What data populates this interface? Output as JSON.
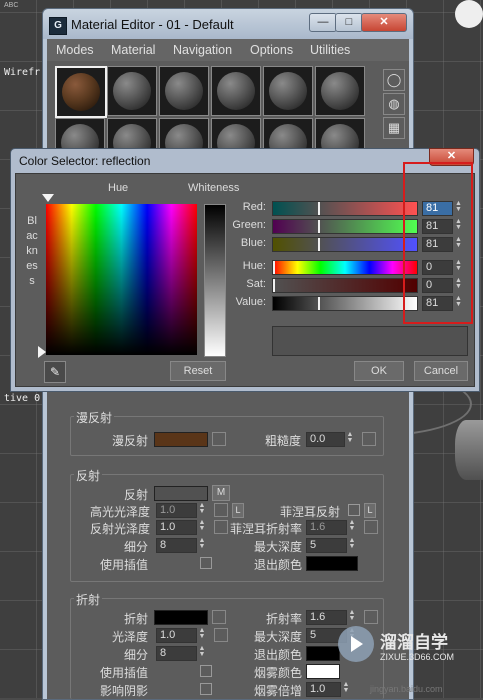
{
  "viewport": {
    "abc_label": "ABC",
    "wireframe_label": "Wirefr",
    "active_label": "tive 0"
  },
  "material_editor": {
    "title": "Material Editor - 01 - Default",
    "app_icon": "G",
    "window_buttons": {
      "minimize": "—",
      "maximize": "□",
      "close": "✕"
    },
    "menus": [
      "Modes",
      "Material",
      "Navigation",
      "Options",
      "Utilities"
    ],
    "side_tools": [
      {
        "name": "sample-type-icon",
        "glyph": "◯"
      },
      {
        "name": "backlight-icon",
        "glyph": "◍"
      },
      {
        "name": "background-checker-icon",
        "glyph": "▦"
      }
    ]
  },
  "color_selector": {
    "title": "Color Selector: reflection",
    "close": "✕",
    "hue_label": "Hue",
    "whiteness_label": "Whiteness",
    "blackness_label": "Blackness",
    "channels": [
      {
        "label": "Red:",
        "value": "81",
        "fraction": 0.318
      },
      {
        "label": "Green:",
        "value": "81",
        "fraction": 0.318
      },
      {
        "label": "Blue:",
        "value": "81",
        "fraction": 0.318
      },
      {
        "label": "Hue:",
        "value": "0",
        "fraction": 0.0
      },
      {
        "label": "Sat:",
        "value": "0",
        "fraction": 0.0
      },
      {
        "label": "Value:",
        "value": "81",
        "fraction": 0.318
      }
    ],
    "eyedropper_icon": "eyedropper-icon",
    "buttons": {
      "reset": "Reset",
      "ok": "OK",
      "cancel": "Cancel"
    },
    "preview_color": "#515151",
    "annotation_color": "#d61c1c"
  },
  "rollout": {
    "diffuse_group": {
      "title": "漫反射",
      "diffuse_label": "漫反射",
      "diffuse_color": "#5a3518",
      "roughness_label": "粗糙度",
      "roughness_value": "0.0"
    },
    "reflection_group": {
      "title": "反射",
      "reflect_label": "反射",
      "reflect_color": "#515151",
      "m_button": "M",
      "hilight_gloss_label": "高光光泽度",
      "hilight_gloss_value": "1.0",
      "l_button": "L",
      "fresnel_label": "菲涅耳反射",
      "refl_gloss_label": "反射光泽度",
      "refl_gloss_value": "1.0",
      "fresnel_ior_label": "菲涅耳折射率",
      "fresnel_ior_value": "1.6",
      "subdivs_label": "细分",
      "subdivs_value": "8",
      "max_depth_label": "最大深度",
      "max_depth_value": "5",
      "use_interp_label": "使用插值",
      "exit_color_label": "退出颜色",
      "exit_color": "#000000"
    },
    "refraction_group": {
      "title": "折射",
      "refract_label": "折射",
      "refract_color": "#000000",
      "ior_label": "折射率",
      "ior_value": "1.6",
      "gloss_label": "光泽度",
      "gloss_value": "1.0",
      "max_depth_label": "最大深度",
      "max_depth_value": "5",
      "subdivs_label": "细分",
      "subdivs_value": "8",
      "exit_color_label": "退出颜色",
      "use_interp_label": "使用插值",
      "fog_color_label": "烟雾颜色",
      "fog_color": "#ffffff",
      "affect_shadows_label": "影响阴影",
      "fog_mult_label": "烟雾倍增",
      "fog_mult_value": "1.0"
    }
  },
  "watermark": {
    "title": "溜溜自学",
    "url": "ZIXUE.3D66.COM",
    "site": "jingyan.baidu.com"
  }
}
